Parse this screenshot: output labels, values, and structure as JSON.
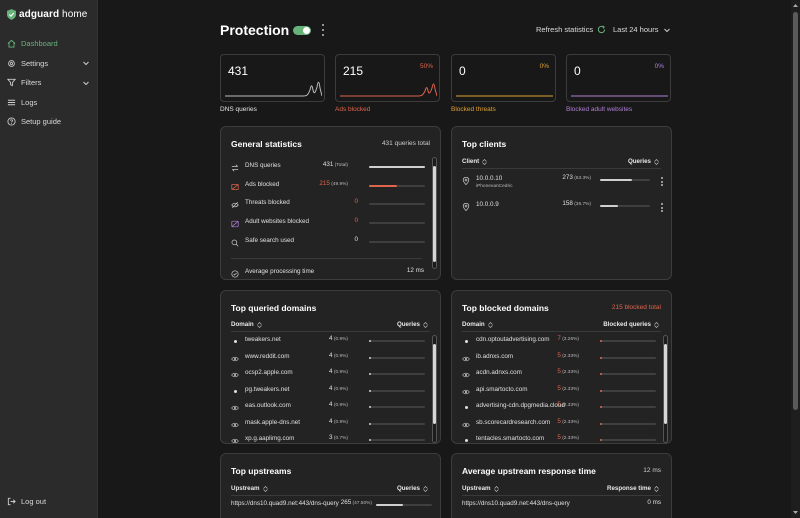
{
  "brand": {
    "name_bold": "adguard",
    "name_rest": " home"
  },
  "nav": [
    {
      "label": "Dashboard",
      "icon": "home-icon",
      "active": true
    },
    {
      "label": "Settings",
      "icon": "gear-icon",
      "has_children": true
    },
    {
      "label": "Filters",
      "icon": "filter-icon",
      "has_children": true
    },
    {
      "label": "Logs",
      "icon": "list-icon"
    },
    {
      "label": "Setup guide",
      "icon": "help-icon"
    }
  ],
  "logout_label": "Log out",
  "header": {
    "title": "Protection",
    "protection_enabled": true,
    "refresh_label": "Refresh statistics",
    "period_label": "Last 24 hours"
  },
  "stats": [
    {
      "value": "431",
      "percent": "",
      "label": "DNS queries",
      "color": "#e6e6e6"
    },
    {
      "value": "215",
      "percent": "50%",
      "label": "Ads blocked",
      "color": "#e0654d"
    },
    {
      "value": "0",
      "percent": "0%",
      "label": "Blocked threats",
      "color": "#e0a132"
    },
    {
      "value": "0",
      "percent": "0%",
      "label": "Blocked adult websites",
      "color": "#b07fd6"
    }
  ],
  "general": {
    "title": "General statistics",
    "note": "431 queries total",
    "rows": [
      {
        "label": "DNS queries",
        "count": "431",
        "pct": " (Total)",
        "fraction": 1.0,
        "color": "#cfcfcf",
        "count_color": "#e0e0e0",
        "icon": "swap-icon"
      },
      {
        "label": "Ads blocked",
        "count": "215",
        "pct": " (49.9%)",
        "fraction": 0.499,
        "color": "#e0654d",
        "count_color": "#e0654d",
        "icon": "ads-blocked-icon"
      },
      {
        "label": "Threats blocked",
        "count": "0",
        "pct": "",
        "fraction": 0,
        "color": "#e0a132",
        "count_color": "#e0654d",
        "icon": "threat-icon"
      },
      {
        "label": "Adult websites blocked",
        "count": "0",
        "pct": "",
        "fraction": 0,
        "color": "#b07fd6",
        "count_color": "#e0654d",
        "icon": "adult-icon"
      },
      {
        "label": "Safe search used",
        "count": "0",
        "pct": "",
        "fraction": 0,
        "color": "#cfcfcf",
        "count_color": "#e0e0e0",
        "icon": "search-icon"
      }
    ],
    "avg_label": "Average processing time",
    "avg_value": "12 ms"
  },
  "clients": {
    "title": "Top clients",
    "col_client": "Client",
    "col_queries": "Queries",
    "rows": [
      {
        "ip": "10.0.0.10",
        "sub": "iPhonevanCedric",
        "count": "273",
        "pct": " (63.3%)",
        "fraction": 0.633
      },
      {
        "ip": "10.0.0.9",
        "sub": "",
        "count": "158",
        "pct": " (36.7%)",
        "fraction": 0.367
      }
    ]
  },
  "queried": {
    "title": "Top queried domains",
    "col_domain": "Domain",
    "col_queries": "Queries",
    "rows": [
      {
        "domain": "tweakers.net",
        "count": "4",
        "pct": " (0.9%)",
        "fraction": 0.009,
        "icon": "dot"
      },
      {
        "domain": "www.reddit.com",
        "count": "4",
        "pct": " (0.9%)",
        "fraction": 0.009,
        "icon": "eye"
      },
      {
        "domain": "ocsp2.apple.com",
        "count": "4",
        "pct": " (0.9%)",
        "fraction": 0.009,
        "icon": "eye"
      },
      {
        "domain": "pg.tweakers.net",
        "count": "4",
        "pct": " (0.9%)",
        "fraction": 0.009,
        "icon": "dot"
      },
      {
        "domain": "eas.outlook.com",
        "count": "4",
        "pct": " (0.9%)",
        "fraction": 0.009,
        "icon": "eye"
      },
      {
        "domain": "mask.apple-dns.net",
        "count": "4",
        "pct": " (0.9%)",
        "fraction": 0.009,
        "icon": "eye"
      },
      {
        "domain": "xp.g.aaplimg.com",
        "count": "3",
        "pct": " (0.7%)",
        "fraction": 0.007,
        "icon": "eye"
      }
    ]
  },
  "blocked": {
    "title": "Top blocked domains",
    "note": "215 blocked total",
    "col_domain": "Domain",
    "col_queries": "Blocked queries",
    "rows": [
      {
        "domain": "cdn.optoutadvertising.com",
        "count": "7",
        "pct": " (3.26%)",
        "fraction": 0.0326,
        "icon": "dot"
      },
      {
        "domain": "ib.adnxs.com",
        "count": "5",
        "pct": " (2.33%)",
        "fraction": 0.0233,
        "icon": "eye"
      },
      {
        "domain": "acdn.adnxs.com",
        "count": "5",
        "pct": " (2.33%)",
        "fraction": 0.0233,
        "icon": "eye"
      },
      {
        "domain": "api.smartocto.com",
        "count": "5",
        "pct": " (2.33%)",
        "fraction": 0.0233,
        "icon": "eye"
      },
      {
        "domain": "advertising-cdn.dpgmedia.cloud",
        "count": "5",
        "pct": " (2.33%)",
        "fraction": 0.0233,
        "icon": "dot"
      },
      {
        "domain": "sb.scorecardresearch.com",
        "count": "5",
        "pct": " (2.33%)",
        "fraction": 0.0233,
        "icon": "eye"
      },
      {
        "domain": "tentacles.smartocto.com",
        "count": "5",
        "pct": " (2.33%)",
        "fraction": 0.0233,
        "icon": "dot"
      }
    ]
  },
  "upstreams": {
    "title": "Top upstreams",
    "col_upstream": "Upstream",
    "col_queries": "Queries",
    "rows": [
      {
        "upstream": "https://dns10.quad9.net:443/dns-query",
        "count": "265",
        "pct": " (47.50%)",
        "fraction": 0.475
      }
    ]
  },
  "response": {
    "title": "Average upstream response time",
    "note": "12 ms",
    "col_upstream": "Upstream",
    "col_time": "Response time",
    "rows": [
      {
        "upstream": "https://dns10.quad9.net:443/dns-query",
        "time": "0 ms"
      }
    ]
  }
}
